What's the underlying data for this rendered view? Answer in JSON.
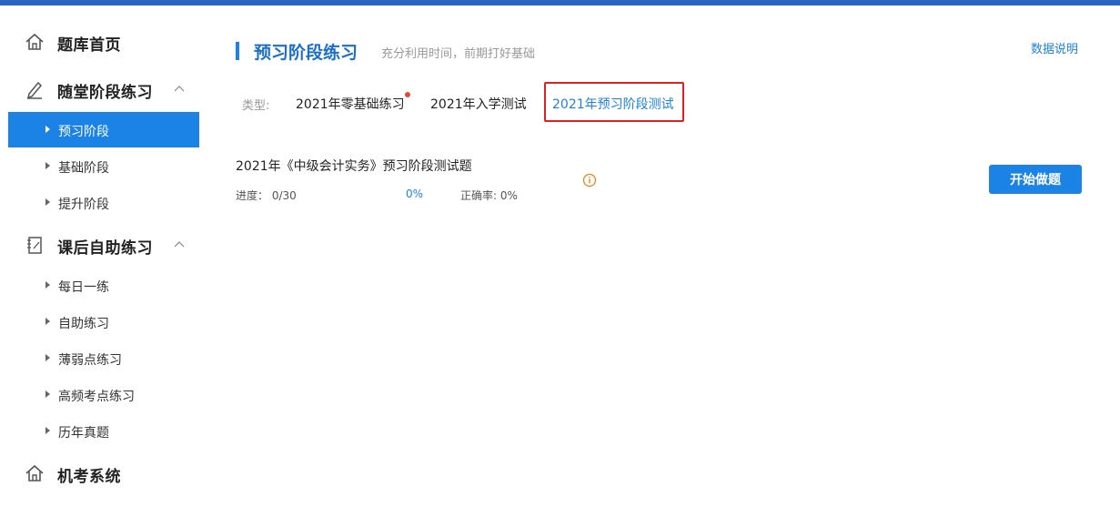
{
  "sidebar": {
    "home": {
      "label": "题库首页",
      "icon": "home-icon"
    },
    "group1": {
      "label": "随堂阶段练习",
      "icon": "pencil-icon",
      "items": [
        {
          "label": "预习阶段",
          "active": true
        },
        {
          "label": "基础阶段"
        },
        {
          "label": "提升阶段"
        }
      ]
    },
    "group2": {
      "label": "课后自助练习",
      "icon": "notebook-icon",
      "items": [
        {
          "label": "每日一练"
        },
        {
          "label": "自助练习"
        },
        {
          "label": "薄弱点练习"
        },
        {
          "label": "高频考点练习"
        },
        {
          "label": "历年真题"
        }
      ]
    },
    "exam": {
      "label": "机考系统",
      "icon": "home-icon"
    }
  },
  "main": {
    "title": "预习阶段练习",
    "subtitle": "充分利用时间，前期打好基础",
    "help_link": "数据说明",
    "type_label": "类型:",
    "tabs": [
      {
        "label": "2021年零基础练习",
        "has_dot": true
      },
      {
        "label": "2021年入学测试"
      },
      {
        "label": "2021年预习阶段测试",
        "active": true
      }
    ],
    "exercise": {
      "title": "2021年《中级会计实务》预习阶段测试题",
      "progress": "进度： 0/30",
      "percent": "0%",
      "accuracy": "正确率: 0%",
      "start_button": "开始做题"
    }
  },
  "colors": {
    "accent": "#1b83e6",
    "topbar": "#2b63c0",
    "highlight_box": "#e02020",
    "dot": "#e8473a"
  }
}
